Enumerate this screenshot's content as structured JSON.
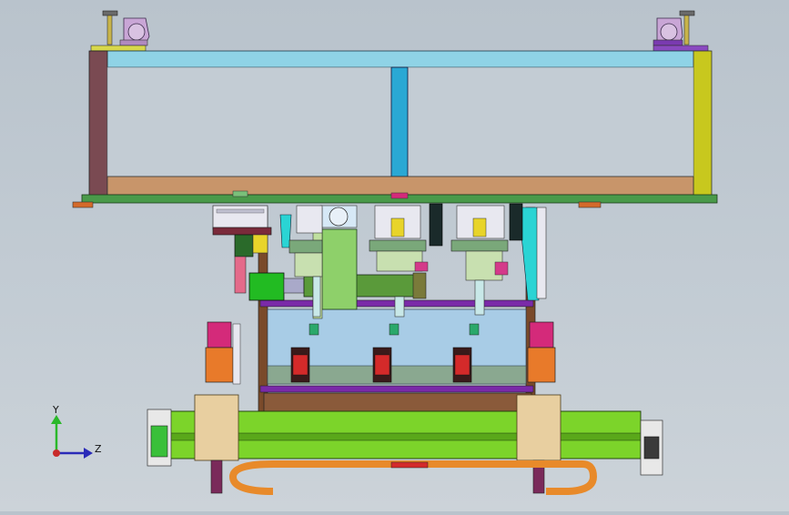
{
  "viewport": {
    "triad": {
      "y_label": "Y",
      "z_label": "Z"
    }
  },
  "colors": {
    "background": "#bfc8d0",
    "frame_top": "#8fd3e6",
    "frame_left": "#7a4a52",
    "frame_right": "#c8c81e",
    "frame_bottom": "#c8956a",
    "center_post": "#2aa8d4",
    "base_plate": "#5a9a5a",
    "rail": "#7cd42a",
    "carriage": "#e8cfa0",
    "cable_chain": "#e88a2a",
    "glass": "#a8cce6",
    "motor_green": "#22bb22",
    "purple_bar": "#7a2aa8",
    "magenta_block": "#d42a7a"
  }
}
